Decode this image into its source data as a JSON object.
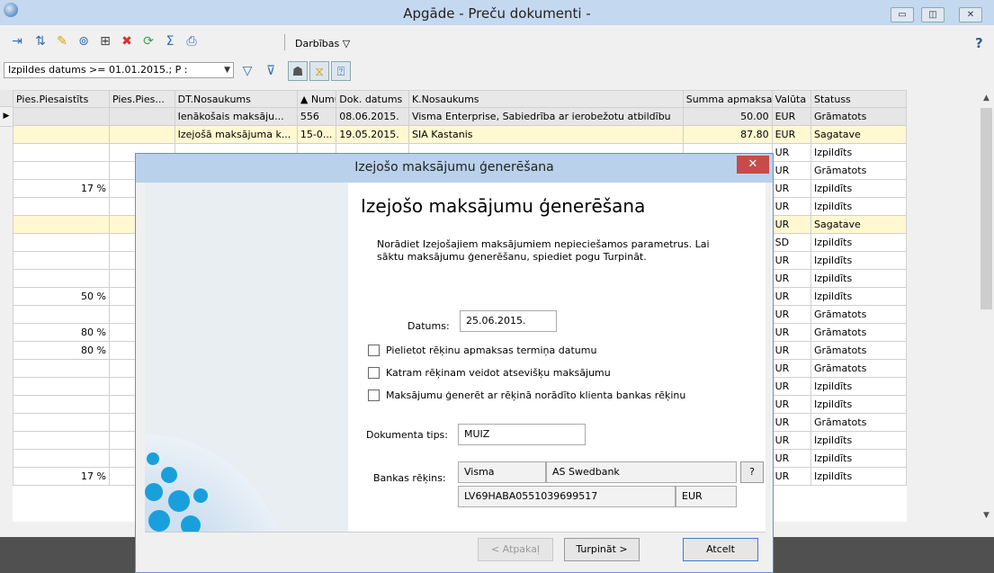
{
  "window": {
    "title": "Apgāde - Preču dokumenti -"
  },
  "toolbar": {
    "darbibas_label": "Darbības ▽",
    "help_glyph": "?"
  },
  "filter": {
    "value": "Izpildes datums >= 01.01.2015.; P :"
  },
  "grid": {
    "columns": [
      "Pies.Piesaistīts",
      "Pies.Pies...",
      "DT.Nosaukums",
      "▲ Numurs",
      "Dok. datums",
      "K.Nosaukums",
      "Summa apmaksai",
      "Valūta",
      "Statuss"
    ],
    "rows": [
      {
        "c0": "",
        "c1": "",
        "c2": "Ienākošais maksāju...",
        "c3": "556",
        "c4": "08.06.2015.",
        "c5": "Visma Enterprise, Sabiedrība ar ierobežotu atbildību",
        "c6": "50.00",
        "c7": "EUR",
        "c8": "Grāmatots"
      },
      {
        "c0": "",
        "c1": "",
        "c2": "Izejošā maksājuma k...",
        "c3": "15-0...",
        "c4": "19.05.2015.",
        "c5": "SIA Kastanis",
        "c6": "87.80",
        "c7": "EUR",
        "c8": "Sagatave"
      },
      {
        "c0": "",
        "c7": "UR",
        "c8": "Izpildīts"
      },
      {
        "c0": "",
        "c7": "UR",
        "c8": "Grāmatots"
      },
      {
        "c0": "17 %",
        "c7": "UR",
        "c8": "Izpildīts"
      },
      {
        "c0": "",
        "c7": "UR",
        "c8": "Izpildīts"
      },
      {
        "c0": "",
        "c7": "UR",
        "c8": "Sagatave"
      },
      {
        "c0": "",
        "c7": "SD",
        "c8": "Izpildīts"
      },
      {
        "c0": "",
        "c7": "UR",
        "c8": "Izpildīts"
      },
      {
        "c0": "",
        "c7": "UR",
        "c8": "Izpildīts"
      },
      {
        "c0": "50 %",
        "c7": "UR",
        "c8": "Izpildīts"
      },
      {
        "c0": "",
        "c7": "UR",
        "c8": "Grāmatots"
      },
      {
        "c0": "80 %",
        "c7": "UR",
        "c8": "Grāmatots"
      },
      {
        "c0": "80 %",
        "c7": "UR",
        "c8": "Grāmatots"
      },
      {
        "c0": "",
        "c7": "UR",
        "c8": "Grāmatots"
      },
      {
        "c0": "",
        "c7": "UR",
        "c8": "Izpildīts"
      },
      {
        "c0": "",
        "c7": "UR",
        "c8": "Izpildīts"
      },
      {
        "c0": "",
        "c7": "UR",
        "c8": "Grāmatots"
      },
      {
        "c0": "",
        "c7": "UR",
        "c8": "Izpildīts"
      },
      {
        "c0": "",
        "c7": "UR",
        "c8": "Izpildīts"
      },
      {
        "c0": "17 %",
        "c7": "UR",
        "c8": "Izpildīts"
      }
    ]
  },
  "dialog": {
    "title": "Izejošo maksājumu ģenerēšana",
    "heading": "Izejošo maksājumu ģenerēšana",
    "description": "Norādiet Izejošajiem maksājumiem nepieciešamos parametrus. Lai sāktu maksājumu ģenerēšanu, spiediet pogu Turpināt.",
    "datums_label": "Datums:",
    "datums_value": "25.06.2015.",
    "check1": "Pielietot rēķinu apmaksas termiņa datumu",
    "check2": "Katram rēķinam veidot atsevišķu maksājumu",
    "check3": "Maksājumu ģenerēt ar rēķinā norādīto klienta bankas rēķinu",
    "doc_tips_label": "Dokumenta tips:",
    "doc_tips_value": "MUIZ",
    "bank_label": "Bankas rēķins:",
    "bank_name": "Visma",
    "bank_bank": "AS Swedbank",
    "bank_pick": "?",
    "bank_iban": "LV69HABA0551039699517",
    "bank_currency": "EUR",
    "btn_back": "< Atpakaļ",
    "btn_next": "Turpināt >",
    "btn_cancel": "Atcelt",
    "close_glyph": "✕"
  }
}
